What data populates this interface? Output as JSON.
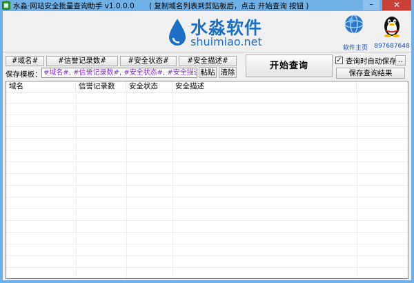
{
  "window": {
    "title": "水淼·网站安全批量查询助手 v1.0.0.0",
    "hint": "( 复制域名列表到剪贴板后，点击 开始查询 按钮 )",
    "min_glyph": "–",
    "close_glyph": "✕"
  },
  "header": {
    "logo_cn": "水淼软件",
    "logo_en": "shuimiao.net",
    "home_label": "软件主页",
    "qq_label": "897687648"
  },
  "toolbar": {
    "tags": [
      "#域名#",
      "#信誉记录数#",
      "#安全状态#",
      "#安全描述#"
    ],
    "template_label": "保存模板：",
    "template_value": "#域名#, #信誉记录数#, #安全状态#, #安全描述#",
    "paste_label": "粘贴",
    "clear_label": "清除",
    "start_label": "开始查询",
    "auto_save_label": "查询时自动保存",
    "auto_save_checked": "✓",
    "dots_label": "..",
    "save_results_label": "保存查询结果"
  },
  "table": {
    "columns": [
      "域名",
      "信誉记录数",
      "安全状态",
      "安全描述"
    ],
    "rows": []
  },
  "colors": {
    "title_bar": "#6fb0e7",
    "close_button": "#c84037",
    "template_text": "#8a2be2",
    "brand_blue": "#1b6fc5"
  }
}
